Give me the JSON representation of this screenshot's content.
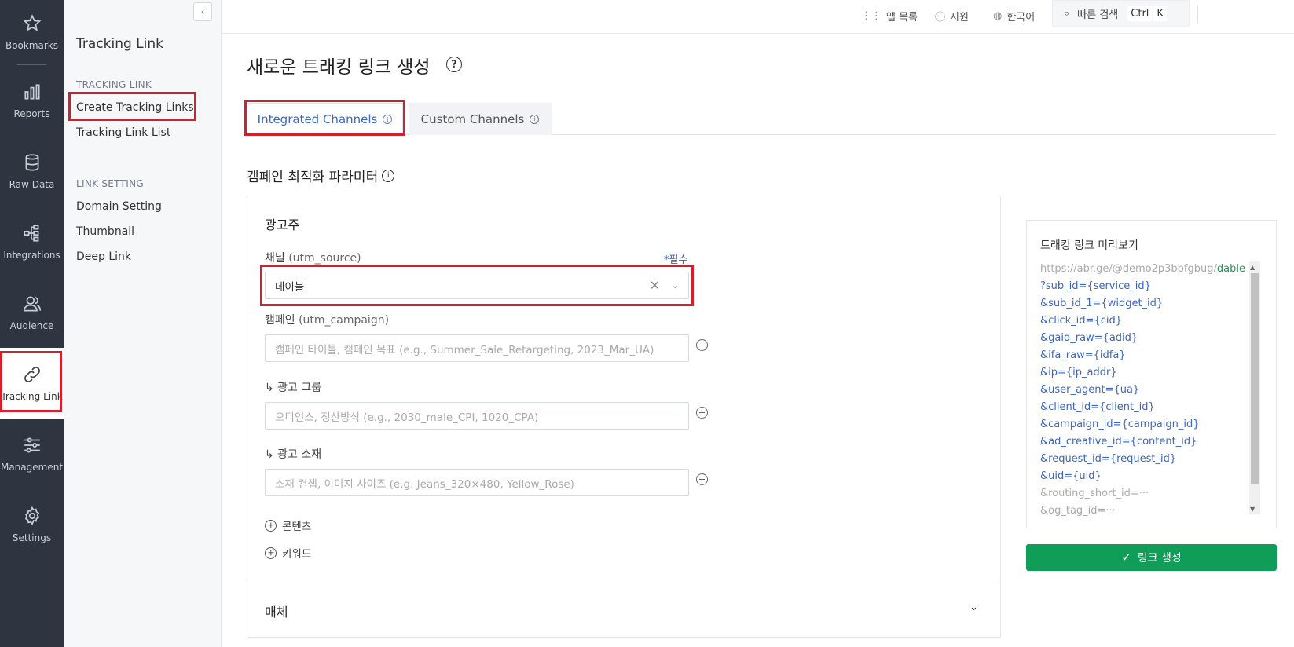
{
  "rail": {
    "items": [
      {
        "label": "Bookmarks",
        "icon": "star-icon"
      },
      {
        "label": "Reports",
        "icon": "bar-chart-icon"
      },
      {
        "label": "Raw Data",
        "icon": "database-icon"
      },
      {
        "label": "Integrations",
        "icon": "integrations-icon"
      },
      {
        "label": "Audience",
        "icon": "audience-icon"
      },
      {
        "label": "Tracking Link",
        "icon": "link-icon"
      },
      {
        "label": "Management",
        "icon": "sliders-icon"
      },
      {
        "label": "Settings",
        "icon": "gear-icon"
      }
    ],
    "active": "Tracking Link"
  },
  "subnav": {
    "title": "Tracking Link",
    "groups": [
      {
        "label": "TRACKING LINK",
        "links": [
          "Create Tracking Links",
          "Tracking Link List"
        ]
      },
      {
        "label": "LINK SETTING",
        "links": [
          "Domain Setting",
          "Thumbnail",
          "Deep Link"
        ]
      }
    ],
    "collapse_glyph": "‹"
  },
  "topbar": {
    "apps": "앱 목록",
    "support": "지원",
    "language": "한국어",
    "search": "빠른 검색",
    "shortcut_ctrl": "Ctrl",
    "shortcut_key": "K"
  },
  "main": {
    "title": "새로운 트래킹 링크 생성",
    "tabs": [
      "Integrated Channels",
      "Custom Channels"
    ],
    "section_title": "캠페인 최적화 파라미터",
    "card_head": "광고주",
    "channel_label": "채널",
    "channel_param": "(utm_source)",
    "required": "*필수",
    "channel_value": "데이블",
    "campaign_label": "캠페인",
    "campaign_param": "(utm_campaign)",
    "campaign_placeholder": "캠페인 타이틀, 캠페인 목표 (e.g., Summer_Sale_Retargeting, 2023_Mar_UA)",
    "adgroup_label": "↳ 광고 그룹",
    "adgroup_placeholder": "오디언스, 정산방식 (e.g., 2030_male_CPI, 1020_CPA)",
    "creative_label": "↳ 광고 소재",
    "creative_placeholder": "소재 컨셉, 이미지 사이즈 (e.g. Jeans_320×480, Yellow_Rose)",
    "add_content": "콘텐츠",
    "add_keyword": "키워드",
    "media_section": "매체"
  },
  "preview": {
    "title": "트래킹 링크 미리보기",
    "base_url": "https://abr.ge/@demo2p3bbfgbug/",
    "base_highlight": "dable",
    "lines": [
      "?sub_id={service_id}",
      "&sub_id_1={widget_id}",
      "&click_id={cid}",
      "&gaid_raw={adid}",
      "&ifa_raw={idfa}",
      "&ip={ip_addr}",
      "&user_agent={ua}",
      "&client_id={client_id}",
      "&campaign_id={campaign_id}",
      "&ad_creative_id={content_id}",
      "&request_id={request_id}",
      "&uid={uid}"
    ],
    "gray_lines": [
      "&routing_short_id=···",
      "&og_tag_id=···"
    ],
    "button": "링크 생성"
  },
  "colors": {
    "rail_bg": "#2e3540",
    "accent_blue": "#3a66c4",
    "highlight_red": "#d61f2c",
    "button_green": "#0f9d58"
  }
}
